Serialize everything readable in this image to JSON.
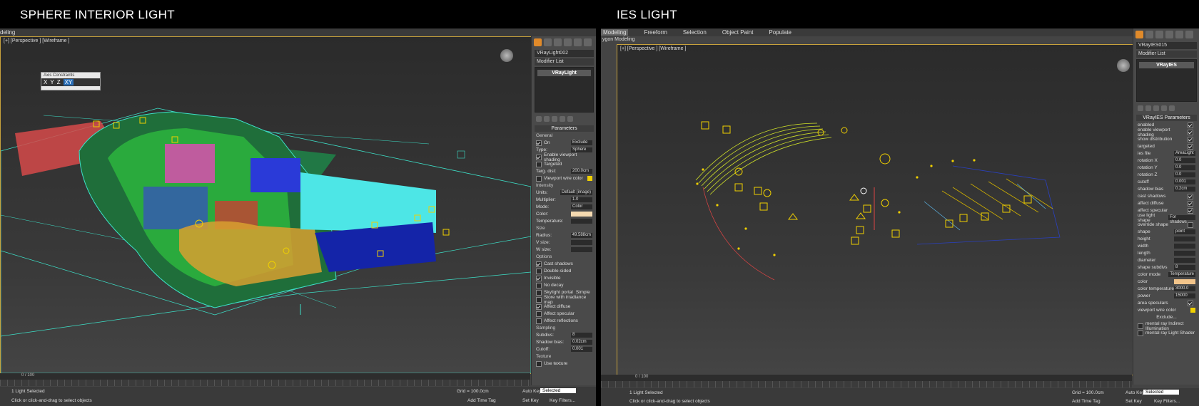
{
  "titles": {
    "left": "SPHERE INTERIOR LIGHT",
    "right": "IES LIGHT"
  },
  "left": {
    "menu_label": "deling",
    "viewport_label": "[+] [Perspective ] [Wireframe ]",
    "axis_constraints": {
      "title": "Axis Constraints",
      "axes": [
        "X",
        "Y",
        "Z",
        "XY"
      ]
    },
    "object_name": "VRayLight002",
    "modifier_list": "Modifier List",
    "stack_item": "VRayLight",
    "rollout_title": "Parameters",
    "general": {
      "group": "General",
      "on": "On",
      "exclude": "Exclude",
      "type_label": "Type:",
      "type_value": "Sphere",
      "enable_viewport_shading": "Enable viewport shading",
      "targeted": "Targeted",
      "targ_dist_label": "Targ. dist:",
      "targ_dist_value": "200.0cm",
      "viewport_wire_color": "Viewport wire color"
    },
    "intensity": {
      "group": "Intensity",
      "units_label": "Units:",
      "units_value": "Default (image)",
      "multiplier_label": "Multiplier:",
      "multiplier_value": "1.0",
      "mode_label": "Mode:",
      "mode_value": "Color",
      "color_label": "Color:",
      "temperature_label": "Temperature:"
    },
    "size": {
      "group": "Size",
      "radius_label": "Radius:",
      "radius_value": "49.588cm",
      "usize_label": "V size:",
      "wsize_label": "W size:"
    },
    "options": {
      "group": "Options",
      "items": [
        "Cast shadows",
        "Double-sided",
        "Invisible",
        "No decay",
        "Skylight portal",
        "Store with irradiance map",
        "Affect diffuse",
        "Affect specular",
        "Affect reflections"
      ],
      "checked": [
        true,
        false,
        true,
        false,
        false,
        false,
        true,
        false,
        false
      ],
      "simple": "Simple"
    },
    "sampling": {
      "group": "Sampling",
      "subdivs_label": "Subdivs:",
      "subdivs_value": "8",
      "shadow_bias_label": "Shadow bias:",
      "shadow_bias_value": "0.02cm",
      "cutoff_label": "Cutoff:",
      "cutoff_value": "0.001"
    },
    "texture": {
      "group": "Texture",
      "use_texture": "Use texture"
    },
    "timeline_frame": "0 / 100",
    "status_selected": "1 Light Selected",
    "status_prompt": "Click or click-and-drag to select objects",
    "grid": "Grid = 100.0cm",
    "auto_key": "Auto Key",
    "selected": "Selected",
    "set_key": "Set Key",
    "key_filters": "Key Filters...",
    "add_time_tag": "Add Time Tag"
  },
  "right": {
    "menu_tabs": [
      "Modeling",
      "Freeform",
      "Selection",
      "Object Paint",
      "Populate"
    ],
    "submenu": "ygon Modeling",
    "viewport_label": "[+] [Perspective ] [Wireframe ]",
    "object_name": "VRayIES015",
    "modifier_list": "Modifier List",
    "stack_item": "VRayIES",
    "rollout_title": "VRayIES Parameters",
    "params": [
      {
        "label": "enabled",
        "type": "check",
        "on": true
      },
      {
        "label": "enable viewport shading",
        "type": "check",
        "on": true
      },
      {
        "label": "show distribution",
        "type": "check",
        "on": true
      },
      {
        "label": "targeted",
        "type": "check",
        "on": true
      },
      {
        "label": "ies file",
        "type": "value",
        "value": "AreaLight"
      },
      {
        "label": "rotation X",
        "type": "value",
        "value": "0.0"
      },
      {
        "label": "rotation Y",
        "type": "value",
        "value": "0.0"
      },
      {
        "label": "rotation Z",
        "type": "value",
        "value": "0.0"
      },
      {
        "label": "cutoff",
        "type": "value",
        "value": "0.001"
      },
      {
        "label": "shadow bias",
        "type": "value",
        "value": "0.2cm"
      },
      {
        "label": "cast shadows",
        "type": "check",
        "on": true
      },
      {
        "label": "affect diffuse",
        "type": "check",
        "on": true
      },
      {
        "label": "affect specular",
        "type": "check",
        "on": true
      },
      {
        "label": "use light shape",
        "type": "value",
        "value": "For shadows"
      },
      {
        "label": "override shape",
        "type": "check",
        "on": false
      },
      {
        "label": "shape",
        "type": "value",
        "value": "point"
      },
      {
        "label": "height",
        "type": "value",
        "value": ""
      },
      {
        "label": "width",
        "type": "value",
        "value": ""
      },
      {
        "label": "length",
        "type": "value",
        "value": ""
      },
      {
        "label": "diameter",
        "type": "value",
        "value": ""
      },
      {
        "label": "shape subdivs",
        "type": "value",
        "value": "8"
      },
      {
        "label": "color mode",
        "type": "value",
        "value": "Temperature"
      },
      {
        "label": "color",
        "type": "swatch",
        "color": "#f2c48a"
      },
      {
        "label": "color temperature",
        "type": "value",
        "value": "3000.0"
      },
      {
        "label": "power",
        "type": "value",
        "value": "15000"
      },
      {
        "label": "area speculars",
        "type": "check",
        "on": true
      },
      {
        "label": "viewport wire color",
        "type": "swatch",
        "color": "#f0d000"
      },
      {
        "label": "Exclude...",
        "type": "button"
      }
    ],
    "mr_indirect": "mental ray Indirect Illumination",
    "mr_shader": "mental ray Light Shader",
    "timeline_frame": "0 / 100",
    "status_selected": "1 Light Selected",
    "status_prompt": "Click or click-and-drag to select objects",
    "grid": "Grid = 100.0cm",
    "auto_key": "Auto Key",
    "selected": "Selected",
    "set_key": "Set Key",
    "key_filters": "Key Filters...",
    "add_time_tag": "Add Time Tag"
  },
  "colors": {
    "accent": "#e08a2a",
    "viewport_border": "#c8a23c",
    "wire_cyan": "#3de0c8",
    "light_yellow": "#f0d000"
  }
}
